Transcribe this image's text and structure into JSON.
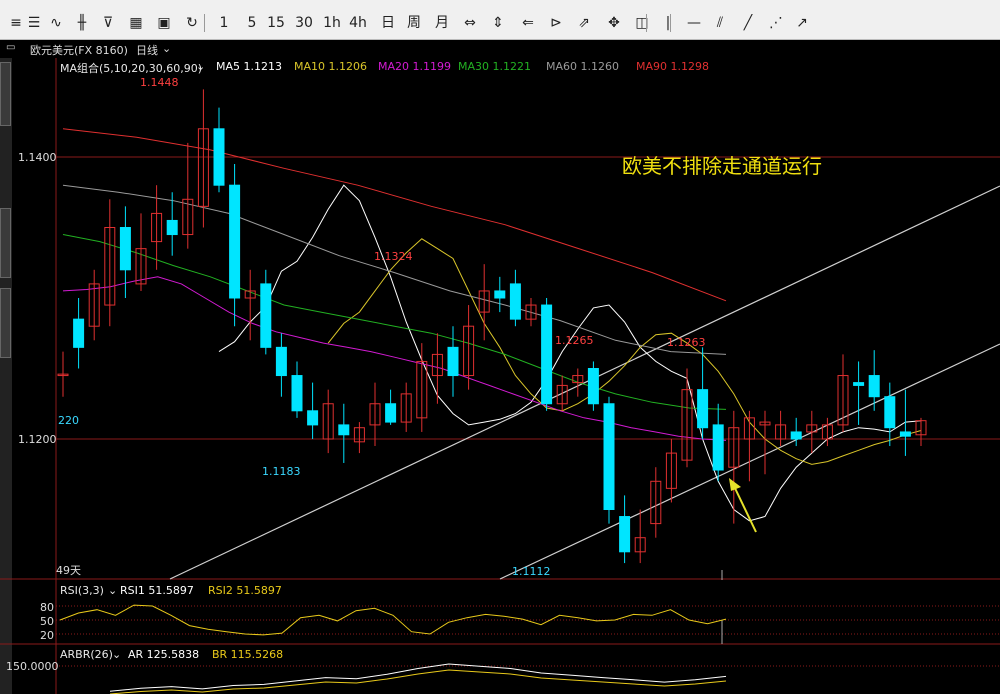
{
  "toolbar": {
    "items": [
      {
        "name": "menu-icon",
        "label": "≡"
      },
      {
        "name": "list-icon",
        "label": "☰"
      },
      {
        "name": "line-chart-icon",
        "label": "∿"
      },
      {
        "name": "kline-icon",
        "label": "╫"
      },
      {
        "name": "indicator-icon",
        "label": "⊽"
      },
      {
        "name": "grid-icon",
        "label": "▦"
      },
      {
        "name": "save-icon",
        "label": "▣"
      },
      {
        "name": "refresh-icon",
        "label": "↻"
      },
      {
        "name": "period-1min",
        "label": "1"
      },
      {
        "name": "period-5min",
        "label": "5"
      },
      {
        "name": "period-15min",
        "label": "15"
      },
      {
        "name": "period-30min",
        "label": "30"
      },
      {
        "name": "period-1h",
        "label": "1h"
      },
      {
        "name": "period-4h",
        "label": "4h"
      },
      {
        "name": "period-day",
        "label": "日"
      },
      {
        "name": "period-week",
        "label": "周"
      },
      {
        "name": "period-month",
        "label": "月"
      },
      {
        "name": "zoom-in-icon",
        "label": "⇔"
      },
      {
        "name": "zoom-out-icon",
        "label": "⇕"
      },
      {
        "name": "move-left-icon",
        "label": "⇐"
      },
      {
        "name": "crosshair-icon",
        "label": "⊳"
      },
      {
        "name": "pointer-icon",
        "label": "⇗"
      },
      {
        "name": "hand-icon",
        "label": "✥"
      },
      {
        "name": "layout-icon",
        "label": "◫"
      },
      {
        "name": "vertical-line-icon",
        "label": "|"
      },
      {
        "name": "horizontal-line-icon",
        "label": "—"
      },
      {
        "name": "channel-icon",
        "label": "⫽"
      },
      {
        "name": "trend-line-icon",
        "label": "╱"
      },
      {
        "name": "fibonacci-icon",
        "label": "⋰"
      },
      {
        "name": "more-icon",
        "label": "↗"
      }
    ]
  },
  "infobar": {
    "symbol": "欧元美元(FX 8160)",
    "period": "日线",
    "dropdown_icon": "chevron-down-icon"
  },
  "ma_legend": {
    "label": "MA组合(5,10,20,30,60,90)",
    "items": [
      {
        "name": "MA5",
        "value": "1.1213",
        "color": "#ffffff"
      },
      {
        "name": "MA10",
        "value": "1.1206",
        "color": "#d9c52a"
      },
      {
        "name": "MA20",
        "value": "1.1199",
        "color": "#d21bd2"
      },
      {
        "name": "MA30",
        "value": "1.1221",
        "color": "#22b022"
      },
      {
        "name": "MA60",
        "value": "1.1260",
        "color": "#9a9a9a"
      },
      {
        "name": "MA90",
        "value": "1.1298",
        "color": "#e03030"
      }
    ]
  },
  "price_axis": {
    "labels": [
      "1.1400",
      "1.1200"
    ]
  },
  "annotations": {
    "high_label": "1.1448",
    "low1_label": "1.1183",
    "peak2_label": "1.1324",
    "low2_label": "1.1112",
    "peak3_label": "1.1265",
    "peak4_label": "1.1263",
    "left_value": "220",
    "days_label": "49天",
    "comment": "欧美不排除走通道运行"
  },
  "rsi_legend": {
    "label": "RSI(3,3)",
    "rsi1": "RSI1 51.5897",
    "rsi2": "RSI2 51.5897"
  },
  "rsi_axis": {
    "labels": [
      "80",
      "50",
      "20"
    ]
  },
  "arbr_legend": {
    "label": "ARBR(26)",
    "ar": "AR 125.5838",
    "br": "BR 115.5268"
  },
  "arbr_axis": {
    "labels": [
      "150.0000"
    ]
  },
  "colors": {
    "up": "#e03030",
    "down": "#00e5ff",
    "channel": "#d0d0d0",
    "arrow": "#e5e12a",
    "comment": "#f0e010",
    "grid_red": "#8a1a1a",
    "rsi_line": "#e8c91a",
    "ar_line": "#ffffff",
    "br_line": "#e8c91a"
  },
  "chart_data": {
    "type": "candlestick",
    "symbol": "欧元美元",
    "period": "日线",
    "ylim": [
      1.11,
      1.147
    ],
    "candles": [
      {
        "o": 1.1245,
        "h": 1.1262,
        "l": 1.123,
        "c": 1.1246
      },
      {
        "o": 1.1285,
        "h": 1.13,
        "l": 1.125,
        "c": 1.1265
      },
      {
        "o": 1.128,
        "h": 1.132,
        "l": 1.127,
        "c": 1.131
      },
      {
        "o": 1.1295,
        "h": 1.137,
        "l": 1.128,
        "c": 1.135
      },
      {
        "o": 1.135,
        "h": 1.1365,
        "l": 1.13,
        "c": 1.132
      },
      {
        "o": 1.131,
        "h": 1.136,
        "l": 1.1305,
        "c": 1.1335
      },
      {
        "o": 1.134,
        "h": 1.138,
        "l": 1.132,
        "c": 1.136
      },
      {
        "o": 1.1355,
        "h": 1.1375,
        "l": 1.133,
        "c": 1.1345
      },
      {
        "o": 1.1345,
        "h": 1.141,
        "l": 1.1335,
        "c": 1.137
      },
      {
        "o": 1.1365,
        "h": 1.1448,
        "l": 1.135,
        "c": 1.142
      },
      {
        "o": 1.142,
        "h": 1.1435,
        "l": 1.1375,
        "c": 1.138
      },
      {
        "o": 1.138,
        "h": 1.1395,
        "l": 1.128,
        "c": 1.13
      },
      {
        "o": 1.13,
        "h": 1.132,
        "l": 1.127,
        "c": 1.1305
      },
      {
        "o": 1.131,
        "h": 1.132,
        "l": 1.126,
        "c": 1.1265
      },
      {
        "o": 1.1265,
        "h": 1.1275,
        "l": 1.123,
        "c": 1.1245
      },
      {
        "o": 1.1245,
        "h": 1.1255,
        "l": 1.1215,
        "c": 1.122
      },
      {
        "o": 1.122,
        "h": 1.124,
        "l": 1.12,
        "c": 1.121
      },
      {
        "o": 1.12,
        "h": 1.1235,
        "l": 1.119,
        "c": 1.1225
      },
      {
        "o": 1.121,
        "h": 1.1225,
        "l": 1.1183,
        "c": 1.1203
      },
      {
        "o": 1.1198,
        "h": 1.1212,
        "l": 1.119,
        "c": 1.1208
      },
      {
        "o": 1.121,
        "h": 1.124,
        "l": 1.1195,
        "c": 1.1225
      },
      {
        "o": 1.1225,
        "h": 1.1235,
        "l": 1.121,
        "c": 1.1212
      },
      {
        "o": 1.1212,
        "h": 1.124,
        "l": 1.1205,
        "c": 1.1232
      },
      {
        "o": 1.1215,
        "h": 1.1268,
        "l": 1.1205,
        "c": 1.1255
      },
      {
        "o": 1.1245,
        "h": 1.1275,
        "l": 1.1225,
        "c": 1.126
      },
      {
        "o": 1.1265,
        "h": 1.128,
        "l": 1.123,
        "c": 1.1245
      },
      {
        "o": 1.1245,
        "h": 1.1295,
        "l": 1.1235,
        "c": 1.128
      },
      {
        "o": 1.129,
        "h": 1.1324,
        "l": 1.127,
        "c": 1.1305
      },
      {
        "o": 1.1305,
        "h": 1.1315,
        "l": 1.129,
        "c": 1.13
      },
      {
        "o": 1.131,
        "h": 1.132,
        "l": 1.128,
        "c": 1.1285
      },
      {
        "o": 1.1285,
        "h": 1.13,
        "l": 1.128,
        "c": 1.1295
      },
      {
        "o": 1.1295,
        "h": 1.13,
        "l": 1.122,
        "c": 1.1225
      },
      {
        "o": 1.1225,
        "h": 1.1245,
        "l": 1.122,
        "c": 1.1238
      },
      {
        "o": 1.124,
        "h": 1.125,
        "l": 1.123,
        "c": 1.1245
      },
      {
        "o": 1.125,
        "h": 1.1255,
        "l": 1.122,
        "c": 1.1225
      },
      {
        "o": 1.1225,
        "h": 1.123,
        "l": 1.114,
        "c": 1.115
      },
      {
        "o": 1.1145,
        "h": 1.116,
        "l": 1.1112,
        "c": 1.112
      },
      {
        "o": 1.112,
        "h": 1.115,
        "l": 1.1112,
        "c": 1.113
      },
      {
        "o": 1.114,
        "h": 1.118,
        "l": 1.113,
        "c": 1.117
      },
      {
        "o": 1.1165,
        "h": 1.12,
        "l": 1.1155,
        "c": 1.119
      },
      {
        "o": 1.1185,
        "h": 1.125,
        "l": 1.118,
        "c": 1.1235
      },
      {
        "o": 1.1235,
        "h": 1.1265,
        "l": 1.12,
        "c": 1.1208
      },
      {
        "o": 1.121,
        "h": 1.1225,
        "l": 1.117,
        "c": 1.1178
      },
      {
        "o": 1.118,
        "h": 1.122,
        "l": 1.114,
        "c": 1.1208
      },
      {
        "o": 1.12,
        "h": 1.122,
        "l": 1.117,
        "c": 1.1215
      },
      {
        "o": 1.121,
        "h": 1.122,
        "l": 1.1175,
        "c": 1.1212
      },
      {
        "o": 1.12,
        "h": 1.122,
        "l": 1.1195,
        "c": 1.121
      },
      {
        "o": 1.1205,
        "h": 1.1215,
        "l": 1.1195,
        "c": 1.12
      },
      {
        "o": 1.1205,
        "h": 1.122,
        "l": 1.119,
        "c": 1.121
      },
      {
        "o": 1.12,
        "h": 1.1215,
        "l": 1.1195,
        "c": 1.121
      },
      {
        "o": 1.121,
        "h": 1.126,
        "l": 1.1205,
        "c": 1.1245
      },
      {
        "o": 1.124,
        "h": 1.1255,
        "l": 1.121,
        "c": 1.1238
      },
      {
        "o": 1.1245,
        "h": 1.1263,
        "l": 1.122,
        "c": 1.123
      },
      {
        "o": 1.123,
        "h": 1.124,
        "l": 1.1195,
        "c": 1.1208
      },
      {
        "o": 1.1205,
        "h": 1.1235,
        "l": 1.1188,
        "c": 1.1202
      },
      {
        "o": 1.1203,
        "h": 1.1215,
        "l": 1.1195,
        "c": 1.1213
      }
    ],
    "ma_series": [
      {
        "name": "MA5",
        "values": [
          1.1262,
          1.1269,
          1.1283,
          1.1294,
          1.1319,
          1.1326,
          1.1343,
          1.1363,
          1.138,
          1.1369,
          1.1343,
          1.1315,
          1.1283,
          1.1256,
          1.1231,
          1.1218,
          1.121,
          1.1212,
          1.1214,
          1.1218,
          1.1226,
          1.1242,
          1.1262,
          1.1278,
          1.1293,
          1.1295,
          1.1283,
          1.1265,
          1.1255,
          1.1248,
          1.1243,
          1.12,
          1.117,
          1.115,
          1.1142,
          1.1145,
          1.1165,
          1.118,
          1.119,
          1.12,
          1.1205,
          1.1208,
          1.1207,
          1.1205,
          1.1212,
          1.1213
        ]
      },
      {
        "name": "MA10",
        "values": [
          1.1268,
          1.1282,
          1.129,
          1.1305,
          1.132,
          1.1332,
          1.1342,
          1.1335,
          1.1328,
          1.1305,
          1.1282,
          1.1265,
          1.1245,
          1.1232,
          1.1222,
          1.122,
          1.1225,
          1.1232,
          1.1241,
          1.1252,
          1.1265,
          1.1274,
          1.1275,
          1.1268,
          1.126,
          1.1248,
          1.1232,
          1.1212,
          1.12,
          1.1192,
          1.1186,
          1.1182,
          1.1184,
          1.1188,
          1.1192,
          1.1196,
          1.1199,
          1.1203,
          1.1206
        ]
      },
      {
        "name": "MA20",
        "values": [
          1.1305,
          1.1306,
          1.1308,
          1.1312,
          1.1315,
          1.131,
          1.13,
          1.129,
          1.1282,
          1.1276,
          1.1272,
          1.1268,
          1.1265,
          1.1262,
          1.1258,
          1.1254,
          1.125,
          1.1244,
          1.1238,
          1.1232,
          1.1226,
          1.122,
          1.1215,
          1.1212,
          1.1208,
          1.1205,
          1.1202,
          1.12,
          1.1199
        ]
      },
      {
        "name": "MA30",
        "values": [
          1.1345,
          1.134,
          1.1332,
          1.1323,
          1.1315,
          1.1305,
          1.1295,
          1.129,
          1.1285,
          1.128,
          1.1275,
          1.1268,
          1.126,
          1.125,
          1.124,
          1.1232,
          1.1226,
          1.1222,
          1.1221
        ]
      },
      {
        "name": "MA60",
        "values": [
          1.138,
          1.1375,
          1.1369,
          1.136,
          1.1345,
          1.133,
          1.1318,
          1.1305,
          1.1295,
          1.1284,
          1.127,
          1.1262,
          1.126
        ]
      },
      {
        "name": "MA90",
        "values": [
          1.142,
          1.1414,
          1.1405,
          1.1392,
          1.138,
          1.1365,
          1.1352,
          1.1335,
          1.1318,
          1.1298
        ]
      }
    ],
    "channel": {
      "upper": [
        [
          1.1,
          1.138
        ]
      ],
      "lower": [
        [
          1.1,
          1.133
        ]
      ]
    },
    "rsi": [
      50,
      65,
      72,
      60,
      82,
      80,
      60,
      38,
      30,
      25,
      20,
      18,
      22,
      55,
      60,
      48,
      70,
      75,
      60,
      25,
      20,
      45,
      55,
      62,
      58,
      52,
      40,
      60,
      55,
      48,
      50,
      62,
      60,
      72,
      50,
      42,
      52
    ],
    "ar": [
      100,
      105,
      108,
      104,
      110,
      112,
      118,
      124,
      122,
      130,
      140,
      148,
      144,
      140,
      132,
      128,
      124,
      120,
      116,
      120,
      126
    ]
  }
}
